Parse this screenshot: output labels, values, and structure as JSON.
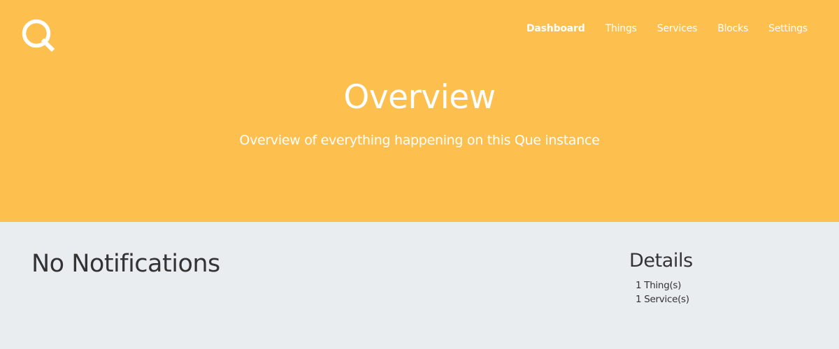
{
  "brand": {
    "logo_icon": "que-logo-icon",
    "accent_color": "#fdbf4d",
    "background_color": "#e9edf0"
  },
  "nav": {
    "items": [
      {
        "label": "Dashboard",
        "active": true
      },
      {
        "label": "Things",
        "active": false
      },
      {
        "label": "Services",
        "active": false
      },
      {
        "label": "Blocks",
        "active": false
      },
      {
        "label": "Settings",
        "active": false
      }
    ]
  },
  "hero": {
    "title": "Overview",
    "subtitle": "Overview of everything happening on this Que instance"
  },
  "notifications": {
    "heading": "No Notifications"
  },
  "details": {
    "heading": "Details",
    "items": [
      "1 Thing(s)",
      "1 Service(s)"
    ]
  }
}
